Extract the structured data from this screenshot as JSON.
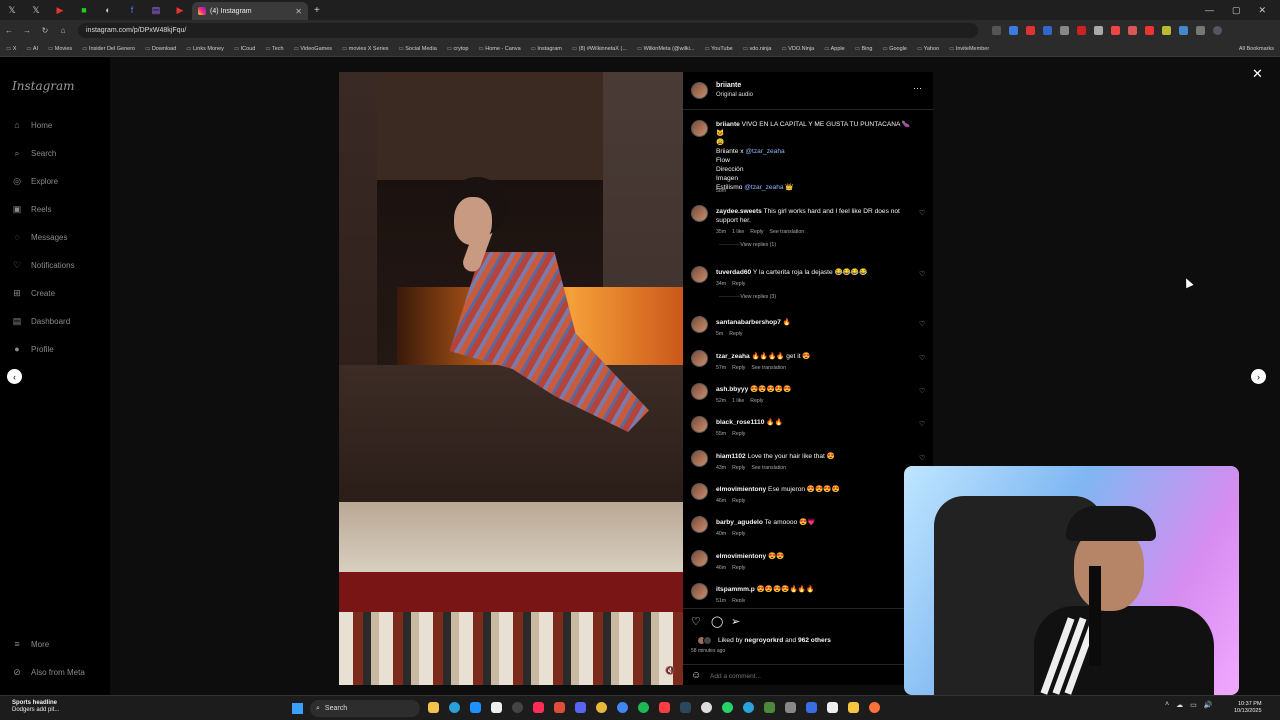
{
  "browser": {
    "active_tab_title": "(4) Instagram",
    "url": "instagram.com/p/DPxW48kjFqu/",
    "bookmarks": [
      "X",
      "AI",
      "Movies",
      "Insider Del Genero",
      "Download",
      "Links Money",
      "ICoud",
      "Tech",
      "VideoGames",
      "movies X Series",
      "Social Media",
      "crytop",
      "Home - Canva",
      "Instagram",
      "(8) #WilkinnetaX (...",
      "WilkinMeta (@wilki...",
      "YouTube",
      "vdo.ninja",
      "VDO.Ninja",
      "Apple",
      "Bing",
      "Google",
      "Yahoo",
      "InviteMember"
    ],
    "all_bookmarks_label": "All Bookmarks"
  },
  "sidebar": {
    "logo": "Instagram",
    "items": [
      {
        "label": "Home",
        "icon": "⌂"
      },
      {
        "label": "Search",
        "icon": "⌕"
      },
      {
        "label": "Explore",
        "icon": "◎"
      },
      {
        "label": "Reels",
        "icon": "▣"
      },
      {
        "label": "Messages",
        "icon": "◌"
      },
      {
        "label": "Notifications",
        "icon": "♡"
      },
      {
        "label": "Create",
        "icon": "⊞"
      },
      {
        "label": "Dashboard",
        "icon": "▤"
      },
      {
        "label": "Profile",
        "icon": "●"
      }
    ],
    "more": "More",
    "also_from_meta": "Also from Meta"
  },
  "post": {
    "username": "briiante",
    "subtitle": "Original audio",
    "caption": {
      "line1": "VIVO EN LA CAPITAL Y ME GUSTA TU PUNTACANA 🍆🐱",
      "line2": "😩",
      "line3_prefix": "Briiante x",
      "line3_mention": "@tzar_zeaha",
      "line4": "Flow",
      "line5": "Dirección",
      "line6": "Imagen",
      "line7_prefix": "Estilismo",
      "line7_mention": "@tzar_zeaha",
      "line7_suffix": "👑",
      "time": "58m"
    },
    "comments": [
      {
        "user": "zaydee.sweets",
        "text": "This girl works hard and I feel like DR does not support her.",
        "time": "35m",
        "likes": "1 like",
        "reply": "Reply",
        "translate": "See translation",
        "view_replies": "View replies (1)"
      },
      {
        "user": "tuverdad60",
        "text": "Y la carterita roja la dejaste 😂😂😂😂",
        "time": "34m",
        "reply": "Reply",
        "view_replies": "View replies (3)"
      },
      {
        "user": "santanabarbershop7",
        "text": "🔥",
        "time": "5m",
        "reply": "Reply"
      },
      {
        "user": "tzar_zeaha",
        "text": "🔥🔥🔥🔥 get it 😍",
        "time": "57m",
        "reply": "Reply",
        "translate": "See translation"
      },
      {
        "user": "ash.bbyyy",
        "text": "😍😍😍😍😍",
        "time": "52m",
        "likes": "1 like",
        "reply": "Reply"
      },
      {
        "user": "black_rose1110",
        "text": "🔥🔥",
        "time": "55m",
        "reply": "Reply"
      },
      {
        "user": "hiam1102",
        "text": "Love the your hair like that 😍",
        "time": "43m",
        "reply": "Reply",
        "translate": "See translation"
      },
      {
        "user": "elmovimientony",
        "text": "Ese mujeron 😍😍😍😍",
        "time": "46m",
        "reply": "Reply"
      },
      {
        "user": "barby_agudelo",
        "text": "Te amoooo 😍💗",
        "time": "40m",
        "reply": "Reply"
      },
      {
        "user": "elmovimientony",
        "text": "😍😍",
        "time": "46m",
        "reply": "Reply"
      },
      {
        "user": "itspammm.p",
        "text": "😍😍😍😍🔥🔥🔥",
        "time": "51m",
        "reply": "Reply"
      }
    ],
    "liked_by_prefix": "Liked by",
    "liked_by_user": "negroyorkrd",
    "liked_by_and": "and",
    "liked_by_others": "962 others",
    "ago": "58 minutes ago",
    "add_comment_placeholder": "Add a comment..."
  },
  "taskbar": {
    "news_headline": "Sports headline",
    "news_sub": "Dodgers add pit...",
    "search_label": "Search",
    "time": "10:37 PM",
    "date": "10/13/2025"
  },
  "colors": {
    "ig_accent": "#3897f0",
    "mention": "#8fb6ff",
    "background": "#000000"
  }
}
